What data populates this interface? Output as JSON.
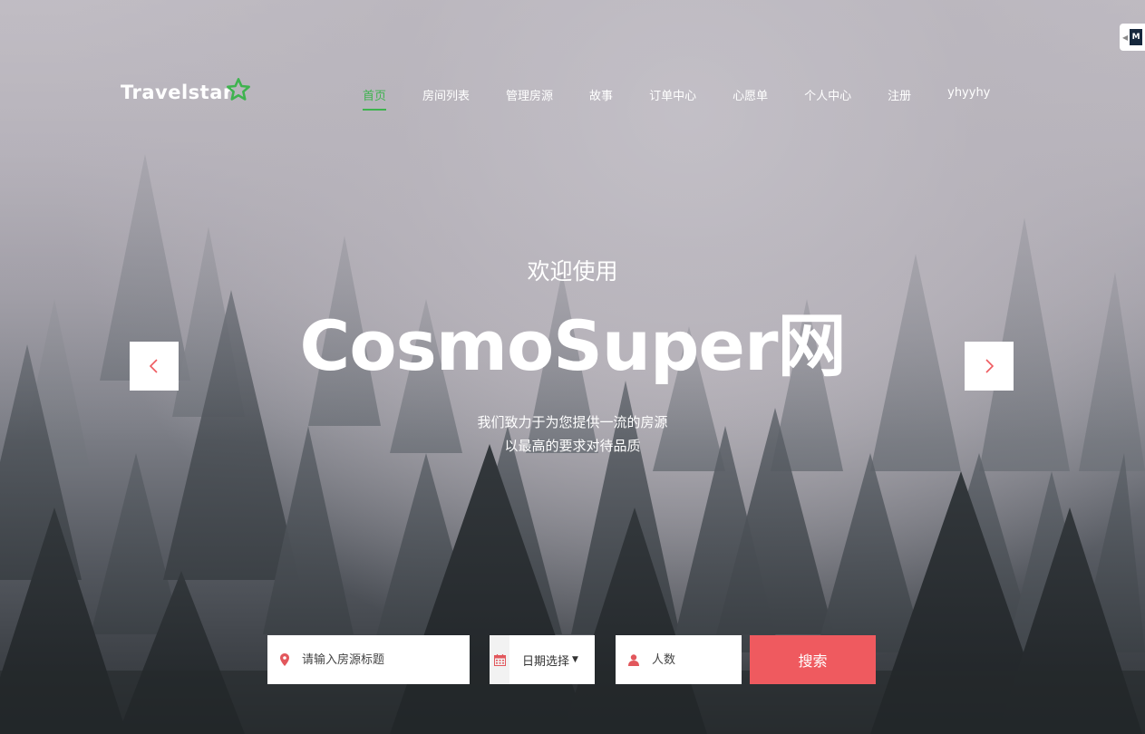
{
  "brand": {
    "logo_text": "Travelstar"
  },
  "nav": {
    "items": [
      {
        "label": "首页",
        "active": true
      },
      {
        "label": "房间列表",
        "active": false
      },
      {
        "label": "管理房源",
        "active": false
      },
      {
        "label": "故事",
        "active": false
      },
      {
        "label": "订单中心",
        "active": false
      },
      {
        "label": "心愿单",
        "active": false
      },
      {
        "label": "个人中心",
        "active": false
      },
      {
        "label": "注册",
        "active": false
      },
      {
        "label": "yhyyhy",
        "active": false
      }
    ]
  },
  "corner_badge": {
    "text": "M"
  },
  "hero": {
    "subtitle": "欢迎使用",
    "title": "CosmoSuper网",
    "desc_line1": "我们致力于为您提供一流的房源",
    "desc_line2": "以最高的要求对待品质"
  },
  "slider": {
    "prev_icon": "chevron-left-icon",
    "next_icon": "chevron-right-icon"
  },
  "search": {
    "title_placeholder": "请输入房源标题",
    "title_value": "",
    "date_label": "日期选择",
    "people_placeholder": "人数",
    "people_value": "",
    "button_label": "搜索"
  },
  "colors": {
    "accent_green": "#3fb34f",
    "search_red": "#ef5a5f",
    "icon_red": "#e2575c"
  }
}
